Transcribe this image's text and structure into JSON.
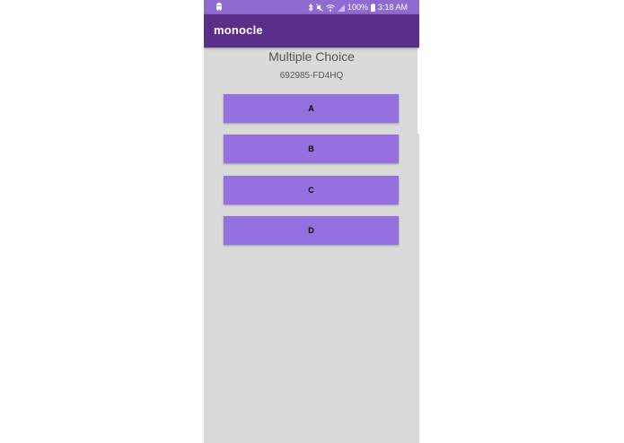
{
  "status_bar": {
    "battery": "100%",
    "time": "3:18 AM",
    "icons": [
      "android-icon",
      "bluetooth-icon",
      "mute-icon",
      "wifi-icon",
      "signal-icon",
      "battery-icon"
    ]
  },
  "app_bar": {
    "title": "monocle"
  },
  "question": {
    "type_label": "Multiple Choice",
    "code": "692985-FD4HQ"
  },
  "choices": [
    "A",
    "B",
    "C",
    "D"
  ],
  "colors": {
    "status_bar": "#8e6bd0",
    "app_bar": "#5a2f8a",
    "button": "#9570df",
    "background": "#dadada"
  }
}
